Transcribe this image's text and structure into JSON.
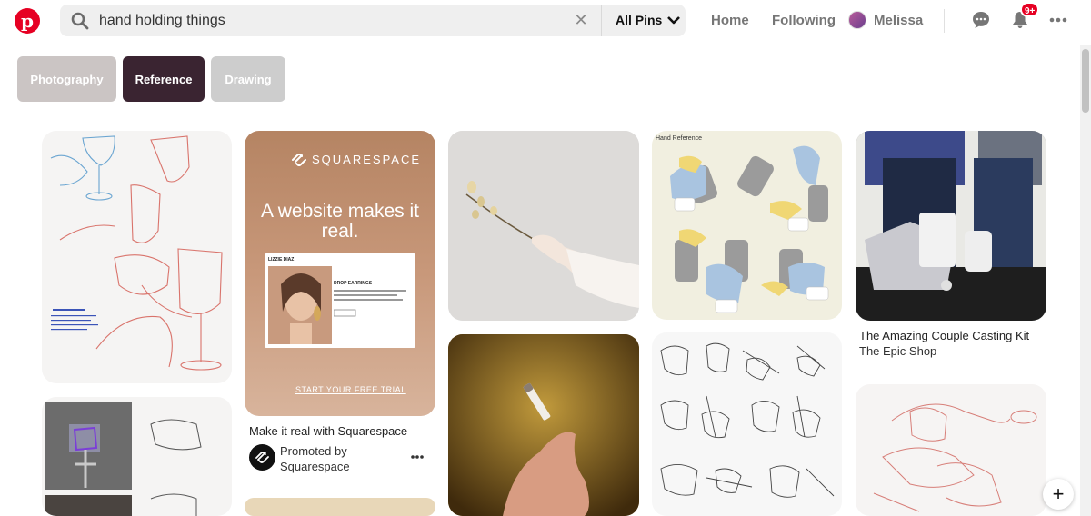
{
  "search": {
    "query": "hand holding things",
    "scope": "All Pins"
  },
  "nav": {
    "home": "Home",
    "following": "Following",
    "user_name": "Melissa",
    "notification_badge": "9+"
  },
  "filters": [
    {
      "label": "Photography",
      "color": "#cbc5c4",
      "selected": false
    },
    {
      "label": "Reference",
      "color": "#3a2431",
      "selected": true
    },
    {
      "label": "Drawing",
      "color": "#cdcdcd",
      "selected": false
    }
  ],
  "pins": {
    "squarespace": {
      "brand": "SQUARESPACE",
      "headline": "A website makes it real.",
      "mock_name": "LIZZIE DIAZ",
      "mock_product": "DROP EARRINGS",
      "cta": "START YOUR FREE TRIAL",
      "title": "Make it real with Squarespace",
      "promoted_label": "Promoted by",
      "advertiser": "Squarespace"
    },
    "hand_reference": {
      "caption": "Hand Reference"
    },
    "casting_kit": {
      "title": "The Amazing Couple Casting Kit",
      "shop": "The Epic Shop"
    }
  },
  "colors": {
    "brand": "#e60023",
    "search_bg": "#efefef",
    "muted_text": "#767676"
  }
}
